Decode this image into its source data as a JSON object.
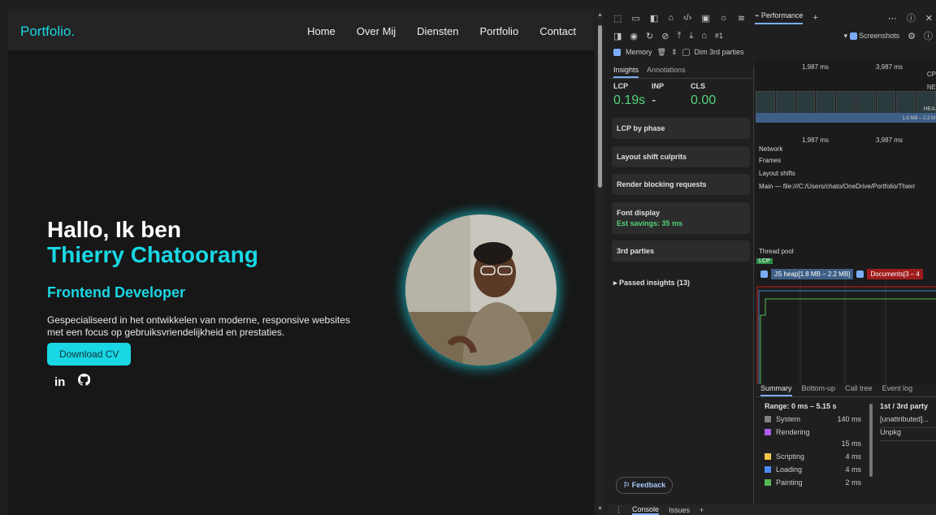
{
  "site": {
    "logo": "Portfolio.",
    "nav": [
      "Home",
      "Over Mij",
      "Diensten",
      "Portfolio",
      "Contact"
    ],
    "greeting": "Hallo, Ik ben",
    "name": "Thierry Chatoorang",
    "role": "Frontend Developer",
    "description": "Gespecialiseerd in het ontwikkelen van moderne, responsive websites met een focus op gebruiksvriendelijkheid en prestaties.",
    "cv_button": "Download CV",
    "socials": [
      "in",
      "github-icon"
    ],
    "accent": "#19d7e4"
  },
  "devtools": {
    "panel_tab": "Performance",
    "recording": "#1",
    "screenshots_label": "Screenshots",
    "memory_label": "Memory",
    "dim_label": "Dim 3rd parties",
    "insights_tabs": [
      "Insights",
      "Annotations"
    ],
    "metrics": [
      {
        "label": "LCP",
        "value": "0.19s"
      },
      {
        "label": "INP",
        "value": "-"
      },
      {
        "label": "CLS",
        "value": "0.00"
      }
    ],
    "cards": [
      {
        "title": "LCP by phase",
        "sub": ""
      },
      {
        "title": "Layout shift culprits",
        "sub": ""
      },
      {
        "title": "Render blocking requests",
        "sub": ""
      },
      {
        "title": "Font display",
        "sub": "Est savings: 35 ms"
      },
      {
        "title": "3rd parties",
        "sub": ""
      }
    ],
    "passed": "▸ Passed insights (13)",
    "feedback": "Feedback",
    "ruler": [
      "1,987 ms",
      "3,987 ms"
    ],
    "ruler_cpu": "CP",
    "ruler_net": "NE",
    "heap_label": "HEA",
    "heap_sub": "1.8 MB – 2.2 M",
    "tracks": [
      "Network",
      "Frames",
      "Layout shifts",
      "Main — file:///C:/Users/chato/OneDrive/Portfolio/Thierr"
    ],
    "thread_pool": "Thread pool",
    "lcp_tag": "LCP",
    "legend": {
      "heap": "JS heap[1.8 MB – 2.2 MB]",
      "docs": "Documents[3 – 4"
    },
    "summary_tabs": [
      "Summary",
      "Bottom-up",
      "Call tree",
      "Event log"
    ],
    "range": "Range: 0 ms – 5.15 s",
    "categories": [
      {
        "name": "System",
        "value": "140 ms",
        "color": "#808080"
      },
      {
        "name": "Rendering",
        "value": "15 ms",
        "color": "#af5cf7"
      },
      {
        "name": "Scripting",
        "value": "4 ms",
        "color": "#f2c54b"
      },
      {
        "name": "Loading",
        "value": "4 ms",
        "color": "#4c8bf5"
      },
      {
        "name": "Painting",
        "value": "2 ms",
        "color": "#54b954"
      }
    ],
    "third_party": {
      "header": "1st / 3rd party",
      "rows": [
        "[unattributed]...",
        "Unpkg"
      ]
    },
    "bottom_tabs": [
      "Console",
      "Issues"
    ]
  }
}
